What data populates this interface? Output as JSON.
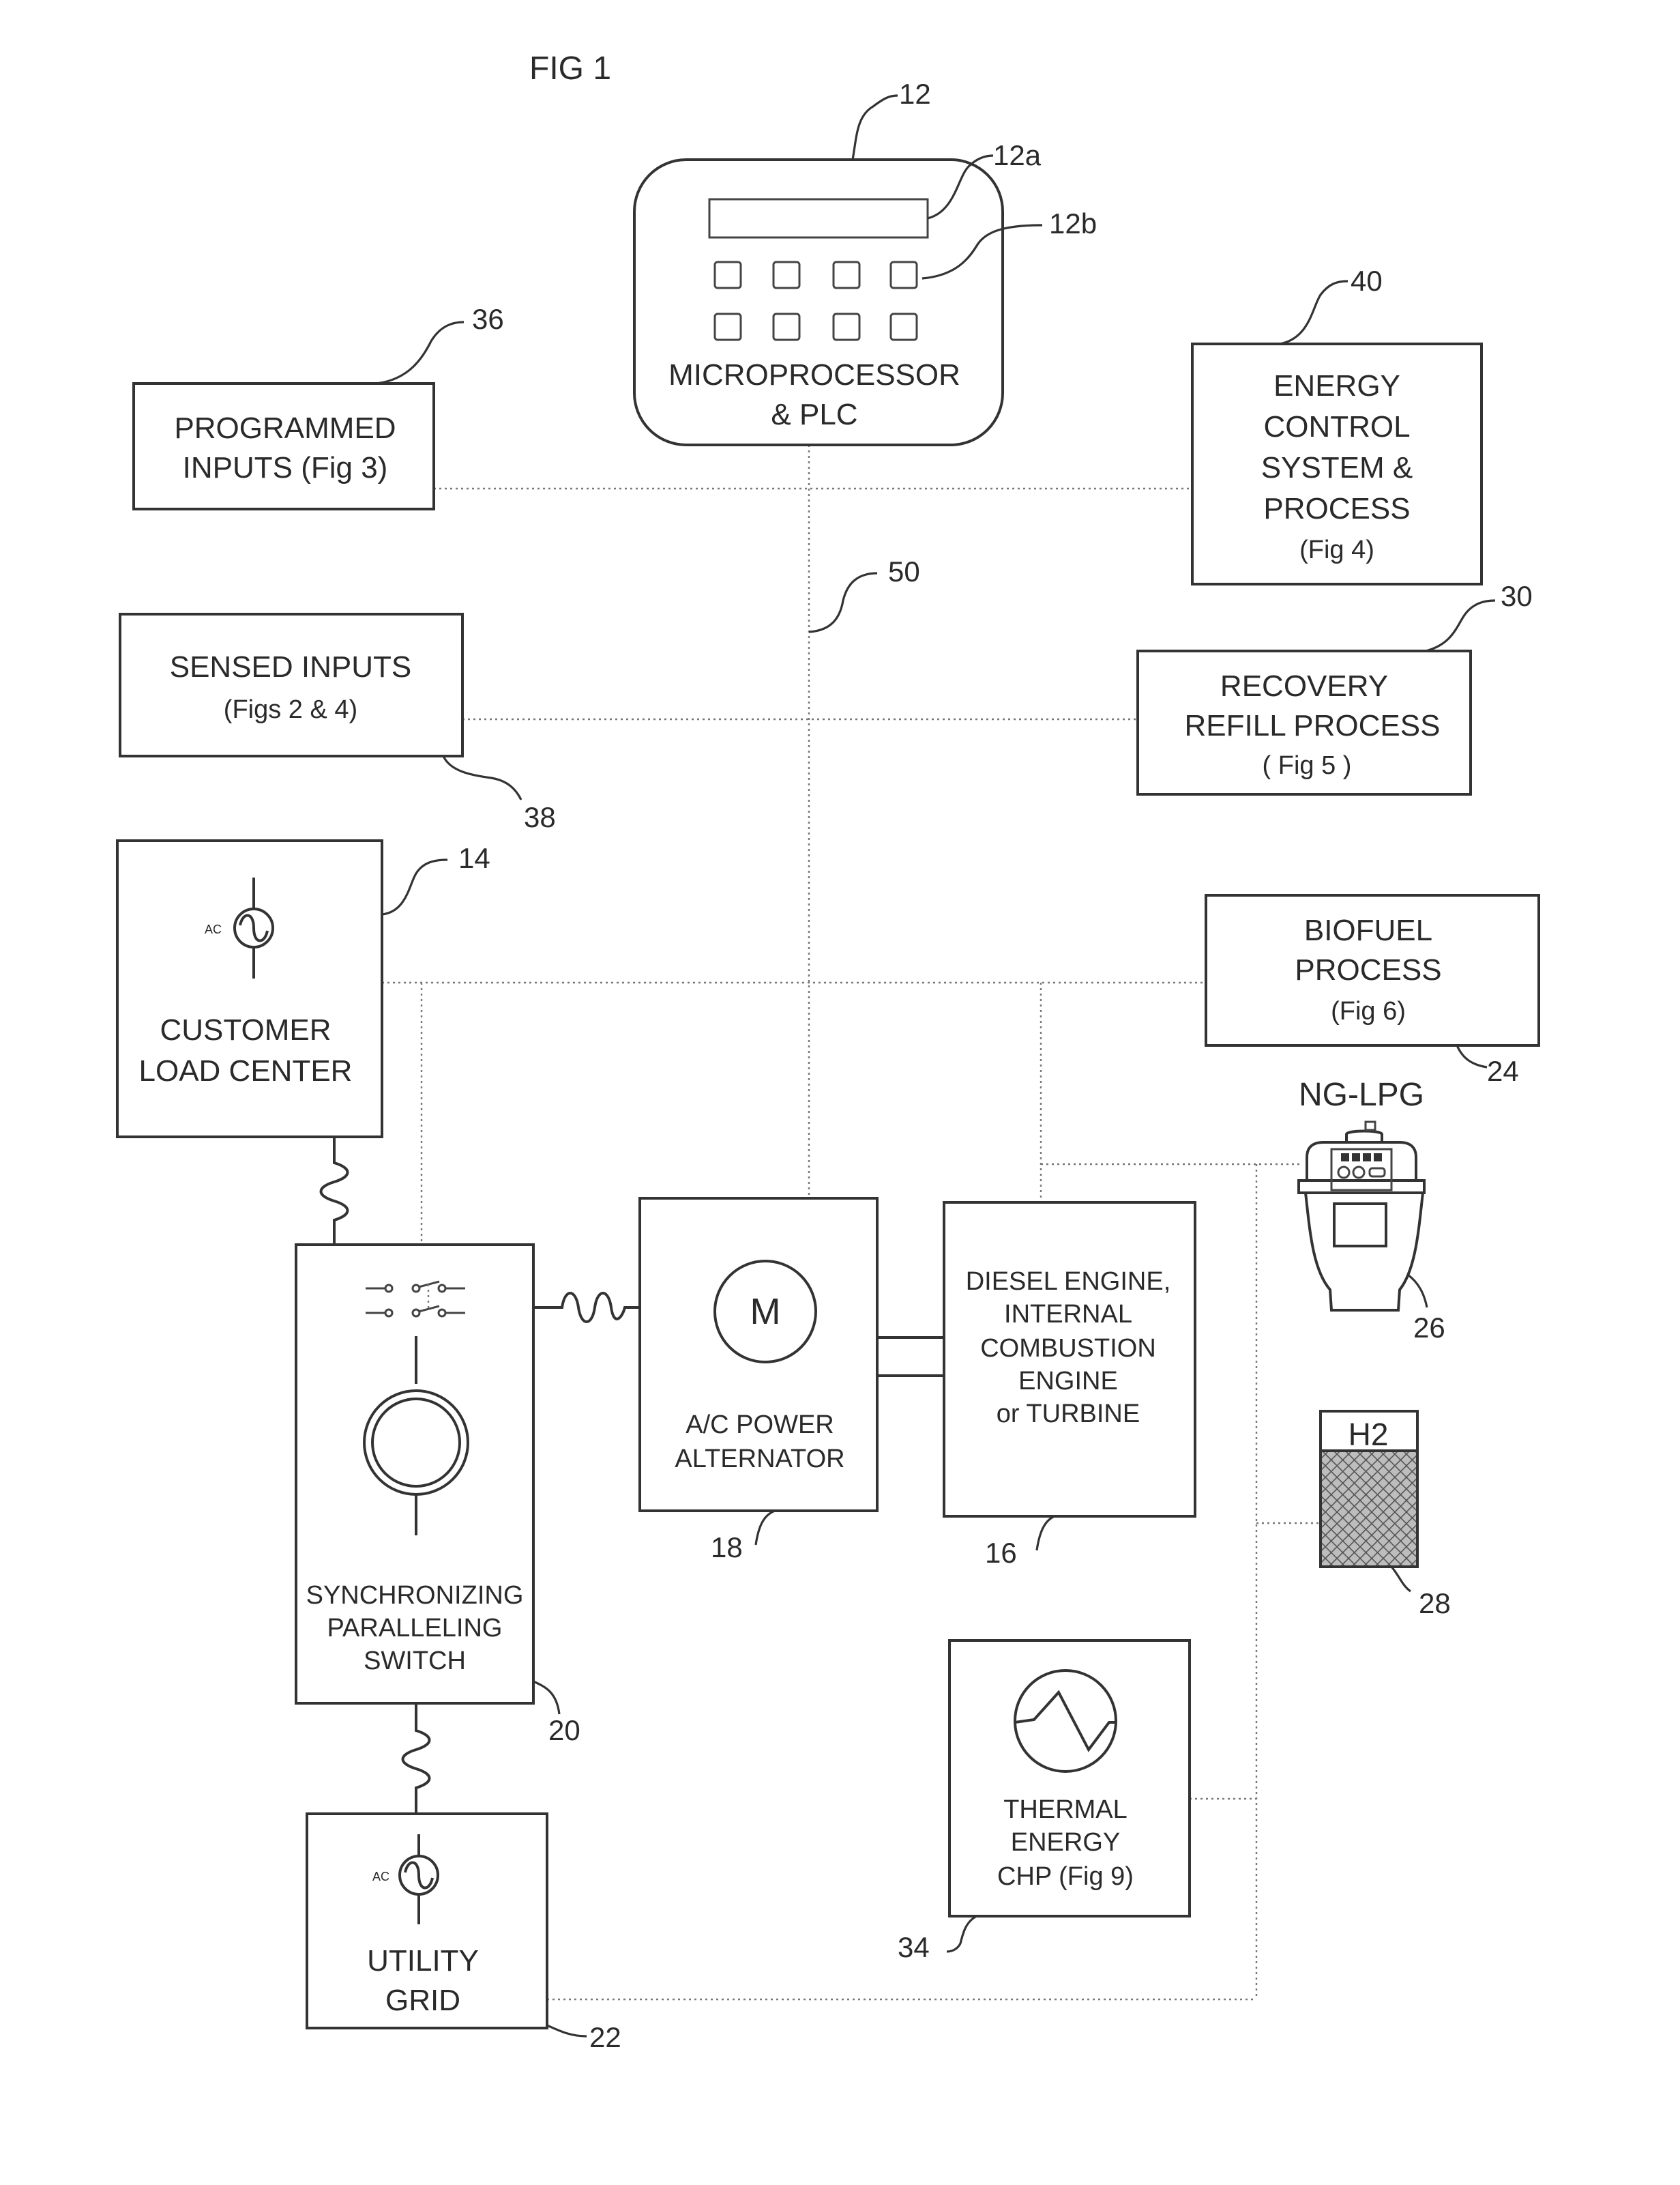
{
  "figure": {
    "title": "FIG 1"
  },
  "components": {
    "microprocessor": {
      "ref": "12",
      "display_ref": "12a",
      "keypad_ref": "12b",
      "lines": [
        "MICROPROCESSOR",
        "& PLC"
      ],
      "keypad_buttons": 8
    },
    "programmed_inputs": {
      "ref": "36",
      "lines": [
        "PROGRAMMED",
        "INPUTS (Fig 3)"
      ]
    },
    "energy_control": {
      "ref": "40",
      "lines": [
        "ENERGY",
        "CONTROL",
        "SYSTEM &",
        "PROCESS",
        "(Fig 4)"
      ]
    },
    "bus": {
      "ref": "50"
    },
    "sensed_inputs": {
      "ref": "38",
      "lines": [
        "SENSED INPUTS",
        "(Figs 2 & 4)"
      ]
    },
    "recovery_refill": {
      "ref": "30",
      "lines": [
        "RECOVERY",
        "REFILL PROCESS",
        "( Fig 5 )"
      ]
    },
    "customer_load_center": {
      "ref": "14",
      "ac_label": "AC",
      "lines": [
        "CUSTOMER",
        "LOAD CENTER"
      ]
    },
    "biofuel": {
      "ref": "24",
      "lines": [
        "BIOFUEL",
        "PROCESS",
        "(Fig 6)"
      ]
    },
    "ng_lpg": {
      "ref": "26",
      "label": "NG-LPG"
    },
    "switch": {
      "ref": "20",
      "lines": [
        "SYNCHRONIZING",
        "PARALLELING",
        "SWITCH"
      ]
    },
    "alternator": {
      "ref": "18",
      "symbol": "M",
      "lines": [
        "A/C POWER",
        "ALTERNATOR"
      ]
    },
    "engine": {
      "ref": "16",
      "lines": [
        "DIESEL ENGINE,",
        "INTERNAL",
        "COMBUSTION",
        "ENGINE",
        "or TURBINE"
      ]
    },
    "hydrogen": {
      "ref": "28",
      "label": "H2"
    },
    "thermal": {
      "ref": "34",
      "lines": [
        "THERMAL",
        "ENERGY",
        "CHP (Fig 9)"
      ]
    },
    "utility_grid": {
      "ref": "22",
      "ac_label": "AC",
      "lines": [
        "UTILITY",
        "GRID"
      ]
    }
  }
}
